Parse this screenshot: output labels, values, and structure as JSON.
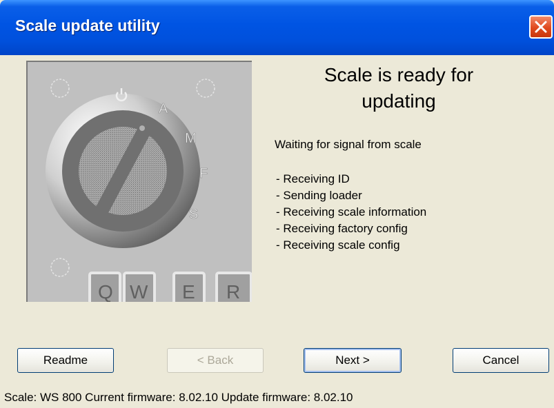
{
  "window": {
    "title": "Scale update utility"
  },
  "illustration": {
    "dial_labels": [
      "A",
      "M",
      "F",
      "S"
    ],
    "key_labels": [
      "Q",
      "W",
      "E",
      "R"
    ]
  },
  "main": {
    "heading": "Scale is ready for updating",
    "status": "Waiting for signal from scale",
    "steps": [
      "- Receiving ID",
      "- Sending loader",
      "- Receiving scale information",
      "- Receiving factory config",
      "- Receiving scale config"
    ]
  },
  "buttons": {
    "readme": "Readme",
    "back": "< Back",
    "next": "Next >",
    "cancel": "Cancel"
  },
  "statusbar": {
    "text": "Scale: WS 800 Current firmware: 8.02.10 Update firmware: 8.02.10"
  },
  "icons": {
    "close": "close-icon",
    "power": "power-icon"
  }
}
